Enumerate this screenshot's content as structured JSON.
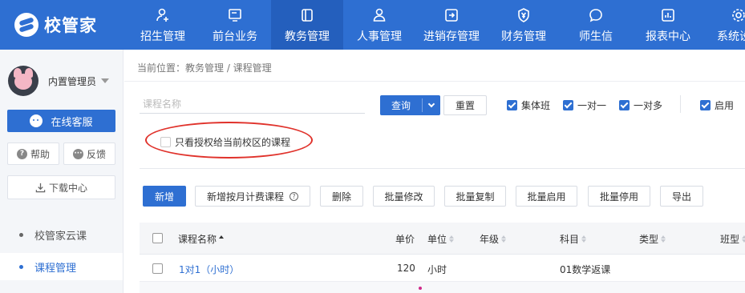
{
  "app": {
    "logo_text": "校管家"
  },
  "topnav": {
    "items": [
      {
        "label": "招生管理",
        "icon": "person-plus-icon"
      },
      {
        "label": "前台业务",
        "icon": "monitor-icon"
      },
      {
        "label": "教务管理",
        "icon": "book-icon",
        "active": true
      },
      {
        "label": "人事管理",
        "icon": "person-icon"
      },
      {
        "label": "进销存管理",
        "icon": "box-arrow-icon"
      },
      {
        "label": "财务管理",
        "icon": "yen-shield-icon"
      },
      {
        "label": "师生信",
        "icon": "chat-bubble-icon"
      },
      {
        "label": "报表中心",
        "icon": "bar-chart-icon"
      },
      {
        "label": "系统设",
        "icon": "gear-icon"
      }
    ]
  },
  "sidebar": {
    "user_name": "内置管理员",
    "service_label": "在线客服",
    "help_label": "帮助",
    "feedback_label": "反馈",
    "download_label": "下载中心",
    "links": [
      {
        "label": "校管家云课",
        "active": false
      },
      {
        "label": "课程管理",
        "active": true
      }
    ]
  },
  "breadcrumb": "当前位置：教务管理 / 课程管理",
  "filters": {
    "search_placeholder": "课程名称",
    "query_label": "查询",
    "reset_label": "重置",
    "checkboxes": [
      {
        "label": "集体班",
        "checked": true
      },
      {
        "label": "一对一",
        "checked": true
      },
      {
        "label": "一对多",
        "checked": true
      },
      {
        "label": "启用",
        "checked": true
      }
    ],
    "auth_only_label": "只看授权给当前校区的课程"
  },
  "toolbar": {
    "add": "新增",
    "add_monthly": "新增按月计费课程",
    "delete": "删除",
    "batch_edit": "批量修改",
    "batch_copy": "批量复制",
    "batch_enable": "批量启用",
    "batch_disable": "批量停用",
    "export": "导出"
  },
  "table": {
    "columns": {
      "name": "课程名称",
      "price": "单价",
      "unit": "单位",
      "grade": "年级",
      "subject": "科目",
      "type": "类型",
      "class_type": "班型"
    },
    "rows": [
      {
        "name": "1对1（小时）",
        "price": "120",
        "unit": "小时",
        "grade": "",
        "subject": "01数学返课",
        "type": "",
        "class_type": ""
      }
    ]
  },
  "colors": {
    "primary": "#2e6fd2",
    "annotation": "#e0322b"
  }
}
